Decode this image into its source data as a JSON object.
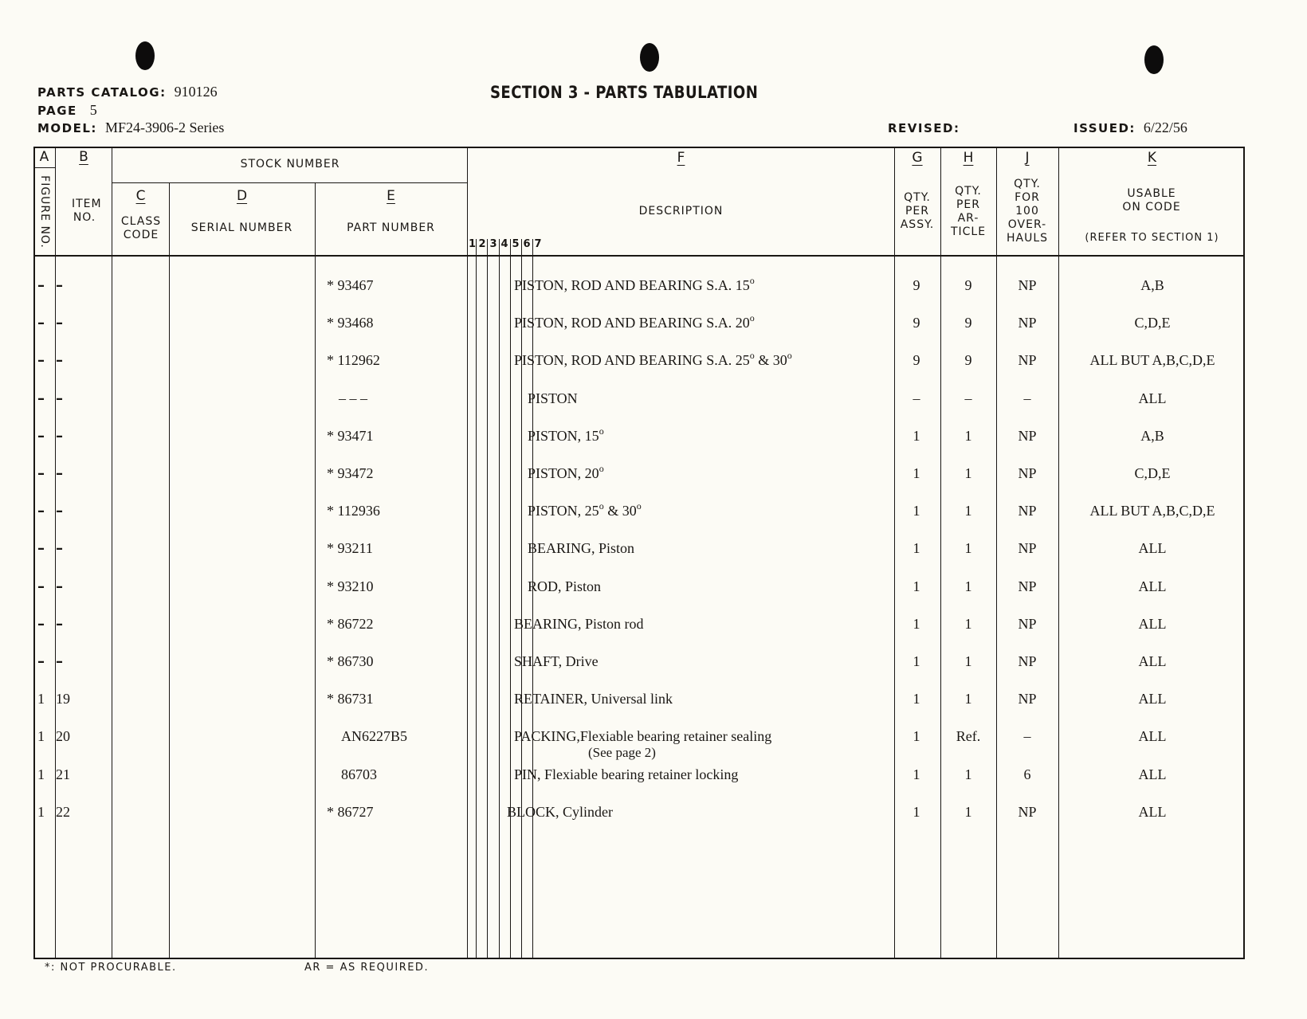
{
  "header": {
    "catalog_label": "PARTS CATALOG:",
    "catalog_value": "910126",
    "page_label": "PAGE",
    "page_value": "5",
    "model_label": "MODEL:",
    "model_value": "MF24-3906-2 Series",
    "title": "SECTION 3 - PARTS TABULATION",
    "revised_label": "REVISED:",
    "revised_value": "",
    "issued_label": "ISSUED:",
    "issued_value": "6/22/56"
  },
  "columns": {
    "a_letter": "A",
    "a_label": "FIGURE NO.",
    "b_letter": "B",
    "b_label": "ITEM NO.",
    "stock_number": "STOCK NUMBER",
    "c_letter": "C",
    "c_label": "CLASS CODE",
    "d_letter": "D",
    "d_label": "SERIAL NUMBER",
    "e_letter": "E",
    "e_label": "PART NUMBER",
    "f_letter": "F",
    "f_label": "DESCRIPTION",
    "f_indent_levels": [
      "1",
      "2",
      "3",
      "4",
      "5",
      "6",
      "7"
    ],
    "g_letter": "G",
    "g_label": "QTY. PER ASSY.",
    "h_letter": "H",
    "h_label": "QTY. PER AR- TICLE",
    "j_letter": "J",
    "j_label": "QTY. FOR 100 OVER- HAULS",
    "k_letter": "K",
    "k_label": "USABLE ON CODE",
    "k_sublabel": "(REFER TO SECTION 1)"
  },
  "rows": [
    {
      "figure": "-",
      "item": "-",
      "part": "* 93467",
      "indent": 2,
      "desc": "PISTON, ROD AND BEARING S.A. 15°",
      "g": "9",
      "h": "9",
      "j": "NP",
      "k": "A,B"
    },
    {
      "figure": "-",
      "item": "-",
      "part": "* 93468",
      "indent": 2,
      "desc": "PISTON, ROD AND BEARING S.A. 20°",
      "g": "9",
      "h": "9",
      "j": "NP",
      "k": "C,D,E"
    },
    {
      "figure": "-",
      "item": "-",
      "part": "* 112962",
      "indent": 2,
      "desc": "PISTON, ROD AND BEARING S.A. 25° & 30°",
      "g": "9",
      "h": "9",
      "j": "NP",
      "k": "ALL BUT A,B,C,D,E"
    },
    {
      "figure": "-",
      "item": "-",
      "part": "---",
      "indent": 3,
      "desc": "PISTON",
      "g": "-",
      "h": "-",
      "j": "-",
      "k": "ALL"
    },
    {
      "figure": "-",
      "item": "-",
      "part": "* 93471",
      "indent": 3,
      "desc": "PISTON, 15°",
      "g": "1",
      "h": "1",
      "j": "NP",
      "k": "A,B"
    },
    {
      "figure": "-",
      "item": "-",
      "part": "* 93472",
      "indent": 3,
      "desc": "PISTON, 20°",
      "g": "1",
      "h": "1",
      "j": "NP",
      "k": "C,D,E"
    },
    {
      "figure": "-",
      "item": "-",
      "part": "* 112936",
      "indent": 3,
      "desc": "PISTON, 25° & 30°",
      "g": "1",
      "h": "1",
      "j": "NP",
      "k": "ALL BUT A,B,C,D,E"
    },
    {
      "figure": "-",
      "item": "-",
      "part": "* 93211",
      "indent": 3,
      "desc": "BEARING, Piston",
      "g": "1",
      "h": "1",
      "j": "NP",
      "k": "ALL"
    },
    {
      "figure": "-",
      "item": "-",
      "part": "* 93210",
      "indent": 3,
      "desc": "ROD, Piston",
      "g": "1",
      "h": "1",
      "j": "NP",
      "k": "ALL"
    },
    {
      "figure": "-",
      "item": "-",
      "part": "* 86722",
      "indent": 2,
      "desc": "BEARING, Piston rod",
      "g": "1",
      "h": "1",
      "j": "NP",
      "k": "ALL"
    },
    {
      "figure": "-",
      "item": "-",
      "part": "* 86730",
      "indent": 2,
      "desc": "SHAFT, Drive",
      "g": "1",
      "h": "1",
      "j": "NP",
      "k": "ALL"
    },
    {
      "figure": "1",
      "item": "19",
      "part": "* 86731",
      "indent": 2,
      "desc": "RETAINER, Universal link",
      "g": "1",
      "h": "1",
      "j": "NP",
      "k": "ALL"
    },
    {
      "figure": "1",
      "item": "20",
      "part": "AN6227B5",
      "indent": 2,
      "desc": "PACKING,Flexiable bearing retainer sealing",
      "desc2": "(See page 2)",
      "g": "1",
      "h": "Ref.",
      "j": "-",
      "k": "ALL"
    },
    {
      "figure": "1",
      "item": "21",
      "part": "86703",
      "indent": 2,
      "desc": "PIN, Flexiable bearing retainer locking",
      "g": "1",
      "h": "1",
      "j": "6",
      "k": "ALL"
    },
    {
      "figure": "1",
      "item": "22",
      "part": "* 86727",
      "indent": 1,
      "desc": "BLOCK, Cylinder",
      "g": "1",
      "h": "1",
      "j": "NP",
      "k": "ALL"
    }
  ],
  "footer": {
    "note_not_procurable": "*: NOT PROCURABLE.",
    "note_as_required": "AR = AS REQUIRED."
  }
}
